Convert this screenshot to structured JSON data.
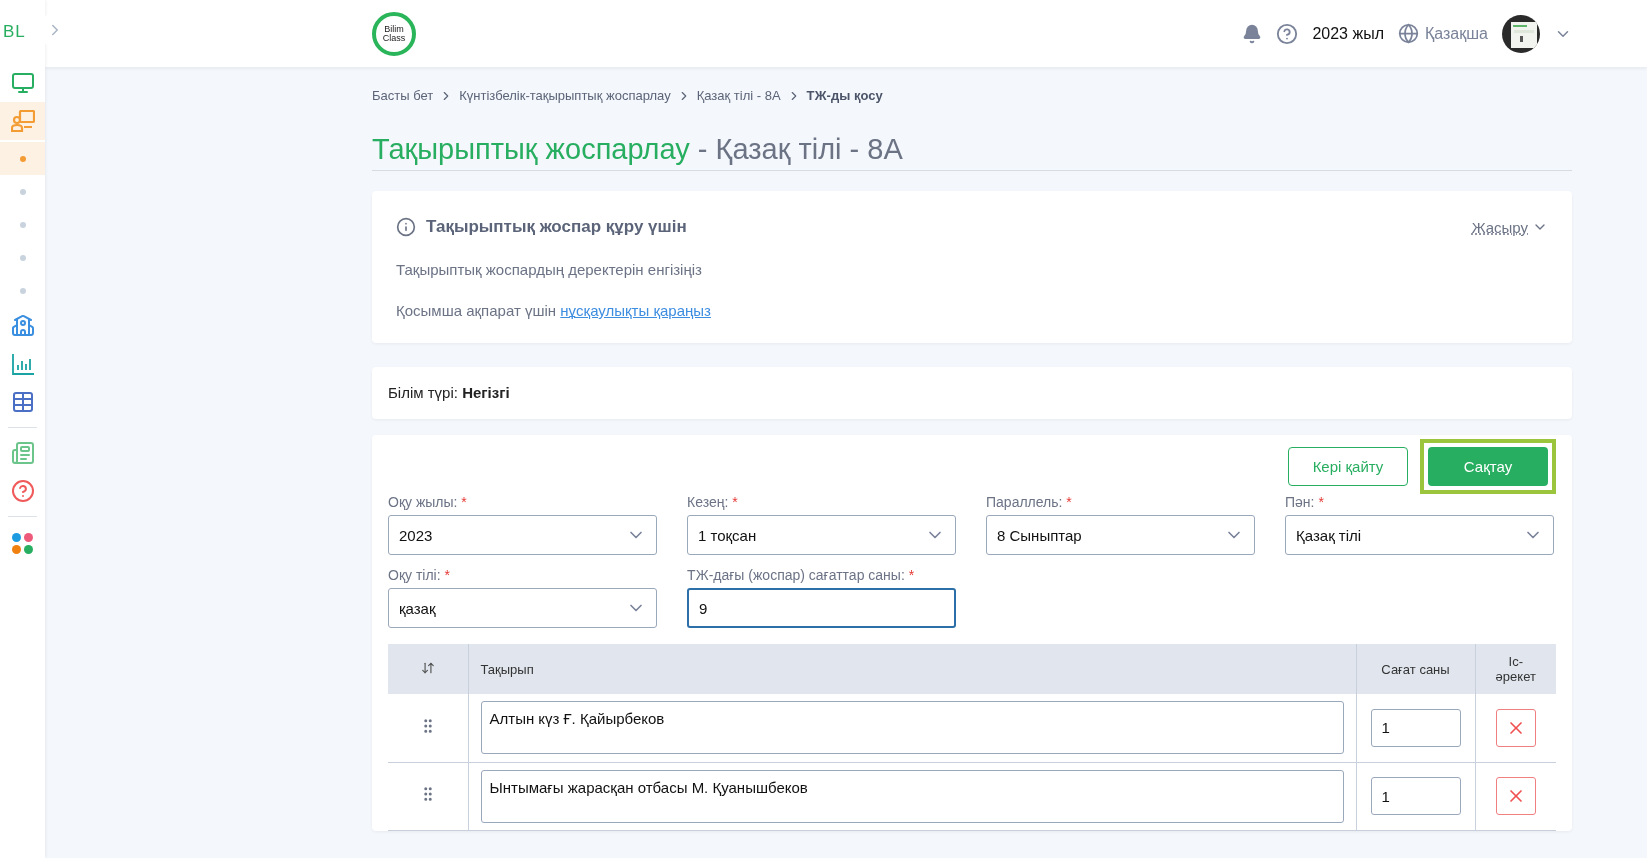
{
  "sidebar": {
    "logo": "BL",
    "items": [
      {
        "kind": "nav",
        "selected": false,
        "color": "#27ae60"
      },
      {
        "kind": "nav",
        "selected": true,
        "color": "#f39c34"
      },
      {
        "kind": "dot",
        "selected": true
      },
      {
        "kind": "dot",
        "selected": false
      },
      {
        "kind": "dot",
        "selected": false
      },
      {
        "kind": "dot",
        "selected": false
      },
      {
        "kind": "dot",
        "selected": false
      },
      {
        "kind": "nav",
        "selected": false,
        "color": "#3b8fe0"
      },
      {
        "kind": "nav",
        "selected": false,
        "color": "#1aa3a3"
      },
      {
        "kind": "nav",
        "selected": false,
        "color": "#4a6fc4"
      },
      {
        "kind": "divider"
      },
      {
        "kind": "nav",
        "selected": false,
        "color": "#6cc58a"
      },
      {
        "kind": "nav",
        "selected": false,
        "color": "#f05a5a"
      },
      {
        "kind": "divider"
      },
      {
        "kind": "apps"
      }
    ]
  },
  "header": {
    "logo_top": "Bilim",
    "logo_bottom": "Class",
    "year": "2023 жыл",
    "language": "Қазақша"
  },
  "breadcrumbs": [
    {
      "label": "Басты бет",
      "current": false
    },
    {
      "label": "Күнтізбелік-тақырыптық жоспарлау",
      "current": false
    },
    {
      "label": "Қазақ тілі - 8А",
      "current": false
    },
    {
      "label": "ТЖ-ды қосу",
      "current": true
    }
  ],
  "title": {
    "main": "Тақырыптық жоспарлау",
    "rest": "- Қазақ тілі - 8А"
  },
  "info": {
    "title": "Тақырыптық жоспар құру үшін",
    "toggle": "Жасыру",
    "expanded": true,
    "line": "Тақырыптық жоспардың деректерін енгізіңіз",
    "note": "Қосымша ақпарат үшін",
    "link": "нұсқаулықты қараңыз"
  },
  "education": "Білім түрі: **Негізгі**",
  "buttons": {
    "back": "Кері қайту",
    "save": "Сақтау",
    "save_highlighted": true
  },
  "fields": [
    {
      "label": "Оқу жылы:",
      "required_mark": "*",
      "kind": "select",
      "value": "2023",
      "focused": false
    },
    {
      "label": "Кезең:",
      "required_mark": "*",
      "kind": "select",
      "value": "1 тоқсан",
      "focused": false
    },
    {
      "label": "Параллель:",
      "required_mark": "*",
      "kind": "select",
      "value": "8 Сыныптар",
      "focused": false
    },
    {
      "label": "Пән:",
      "required_mark": "*",
      "kind": "select",
      "value": "Қазақ тілі",
      "focused": false
    },
    {
      "label": "Оқу тілі:",
      "required_mark": "*",
      "kind": "select",
      "value": "қазақ",
      "focused": false
    },
    {
      "label": "ТЖ-дағы (жоспар) сағаттар саны:",
      "required_mark": "*",
      "kind": "input",
      "value": "9",
      "focused": true
    }
  ],
  "table": {
    "columns": [
      "Тақырып",
      "Сағат саны",
      "Іс-әрекет"
    ],
    "rows": [
      {
        "topic": "Алтын күз Ғ. Қайырбеков",
        "hours": "1"
      },
      {
        "topic": "Ынтымағы жарасқан отбасы М. Қуанышбеков",
        "hours": "1"
      }
    ]
  }
}
